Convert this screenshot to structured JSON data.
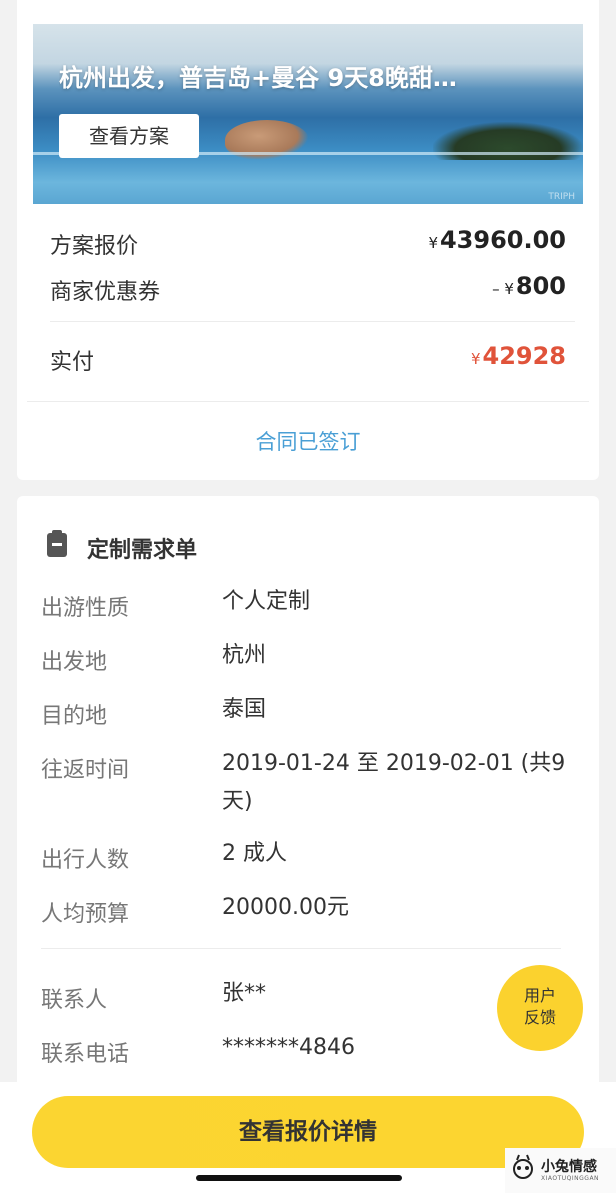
{
  "banner": {
    "title": "杭州出发，普吉岛+曼谷 9天8晚甜…",
    "view_plan_label": "查看方案",
    "watermark": "TRIPH"
  },
  "pricing": {
    "quote_label": "方案报价",
    "quote_symbol": "¥",
    "quote_value": "43960.00",
    "coupon_label": "商家优惠券",
    "coupon_symbol": "– ¥",
    "coupon_value": "800",
    "paid_label": "实付",
    "paid_symbol": "¥",
    "paid_value": "42928",
    "paid_color": "#e0533a"
  },
  "contract_status": "合同已签订",
  "requirements": {
    "section_title": "定制需求单",
    "section_icon": "clipboard-icon",
    "rows": [
      {
        "key": "出游性质",
        "value": "个人定制"
      },
      {
        "key": "出发地",
        "value": "杭州"
      },
      {
        "key": "目的地",
        "value": "泰国"
      },
      {
        "key": "往返时间",
        "value": "2019-01-24 至 2019-02-01 (共9天)"
      },
      {
        "key": "出行人数",
        "value": "2 成人"
      },
      {
        "key": "人均预算",
        "value": "20000.00元"
      }
    ],
    "contact_rows": [
      {
        "key": "联系人",
        "value": "张**"
      },
      {
        "key": "联系电话",
        "value": "*******4846"
      }
    ]
  },
  "feedback_label": "用户\n反馈",
  "feedback_line1": "用户",
  "feedback_line2": "反馈",
  "primary_button": "查看报价详情",
  "accent_color": "#fbd22e",
  "link_color": "#4a9fd5",
  "watermark_logo": {
    "name": "小兔情感",
    "sub": "XIAOTUQINGGAN"
  }
}
